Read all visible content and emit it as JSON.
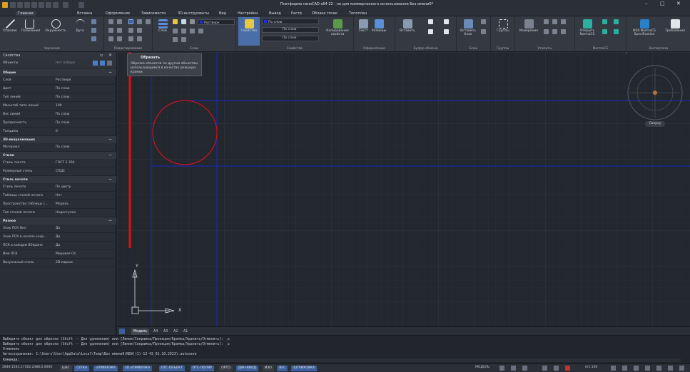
{
  "app": {
    "title": "Платформа nanoCAD x64 22 - не для коммерческого использования Без имени0*"
  },
  "menu": [
    "Главная",
    "Вставка",
    "Оформление",
    "Зависимости",
    "3D-инструменты",
    "Вид",
    "Настройки",
    "Вывод",
    "Растр",
    "Облака точек",
    "Топоплан"
  ],
  "ribbon": {
    "groups": [
      {
        "label": "Черчение",
        "buttons": [
          "Отрезок",
          "Полилиния",
          "Окружность",
          "Дуга"
        ]
      },
      {
        "label": "Редактирование"
      },
      {
        "label": "Слои",
        "buttons": [
          "Слои"
        ]
      },
      {
        "label": "Свойства",
        "buttons": [
          "Свойства",
          "Копирование свойств"
        ],
        "combos": [
          "По слою",
          "По слою",
          "По слою"
        ],
        "layer_combo": "Ростверк"
      },
      {
        "label": "Оформление",
        "buttons": [
          "Текст",
          "Размеры"
        ]
      },
      {
        "label": "Буфер обмена",
        "buttons": [
          "Вставить"
        ]
      },
      {
        "label": "Блок",
        "buttons": [
          "Вставить блок"
        ]
      },
      {
        "label": "Группы",
        "buttons": [
          "Группы"
        ]
      },
      {
        "label": "Утилиты",
        "buttons": [
          "Измерение"
        ]
      },
      {
        "label": "NormaCS",
        "buttons": [
          "Открыть NormaCS"
        ]
      },
      {
        "label": "Экспертиза",
        "buttons": [
          "NSR NormaCS Specification",
          "Требования"
        ]
      }
    ]
  },
  "tooltip": {
    "title": "Обрезать",
    "text": "Обрезка объектов по другим объектам, использующимся в качестве режущих кромок"
  },
  "properties": {
    "title": "Свойства",
    "selection_label": "Объекты",
    "selection_value": "Нет набора",
    "sections": [
      {
        "name": "Общие",
        "rows": [
          {
            "k": "Слой",
            "v": "Ростверк"
          },
          {
            "k": "Цвет",
            "v": "По слою"
          },
          {
            "k": "Тип линий",
            "v": "По слою"
          },
          {
            "k": "Масштаб типа линий",
            "v": "100"
          },
          {
            "k": "Вес линий",
            "v": "По слою"
          },
          {
            "k": "Прозрачность",
            "v": "По слою"
          },
          {
            "k": "Толщина",
            "v": "0"
          }
        ]
      },
      {
        "name": "3D-визуализация",
        "rows": [
          {
            "k": "Материал",
            "v": "По слою"
          }
        ]
      },
      {
        "name": "Стили",
        "rows": [
          {
            "k": "Стиль текста",
            "v": "ГОСТ 2.304"
          },
          {
            "k": "Размерный стиль",
            "v": "СПДС"
          }
        ]
      },
      {
        "name": "Стиль печати",
        "rows": [
          {
            "k": "Стиль печати",
            "v": "По цвету"
          },
          {
            "k": "Таблица стилей печати",
            "v": "Нет"
          },
          {
            "k": "Пространство таблицы с...",
            "v": "Модель"
          },
          {
            "k": "Тип стилей печати",
            "v": "Недоступен"
          }
        ]
      },
      {
        "name": "Разное",
        "rows": [
          {
            "k": "Знак ПСК Вкл",
            "v": "Да"
          },
          {
            "k": "Знак ПСК в начале коор...",
            "v": "Да"
          },
          {
            "k": "ПСК в каждом ВЭкране",
            "v": "Да"
          },
          {
            "k": "Имя ПСК",
            "v": "Мировая СК"
          },
          {
            "k": "Визуальный стиль",
            "v": "2D-каркас"
          }
        ]
      }
    ]
  },
  "viewcube": {
    "label": "Сверху"
  },
  "ucs": {
    "x": "X",
    "y": "Y"
  },
  "layout_tabs": [
    "Модель",
    "A4",
    "A3",
    "A2",
    "A1"
  ],
  "command_lines": [
    "Выберите объект для обрезки (Shift -- Для удлинения) или [Линия/Секрамка/Проекция/Кромка/Удалить/Отменить]: _u",
    "Выберите объект для обрезки (Shift -- Для удлинения) или [Линия/Секрамка/Проекция/Кромка/Удалить/Отменить]: _u",
    "Отменено",
    "Автосохранение: C:\\Users\\User\\AppData\\Local\\Temp\\Без имени0(NEW)(1)-13-43_01.10.2023).autosave",
    "Команда:"
  ],
  "status": {
    "coords": "2849.1544,17162.2488,0.0000",
    "buttons": [
      {
        "label": "ШАГ",
        "on": false
      },
      {
        "label": "СЕТКА",
        "on": true
      },
      {
        "label": "оПРИВЯЗКА",
        "on": true
      },
      {
        "label": "3D оПРИВЯЗКА",
        "on": true
      },
      {
        "label": "ОТС-ОБЪЕКТ",
        "on": true
      },
      {
        "label": "ОТС-ПОЛЯР",
        "on": true
      },
      {
        "label": "ОРТО",
        "on": false
      },
      {
        "label": "ДИН-ВВОД",
        "on": true
      },
      {
        "label": "ИЗО",
        "on": false
      },
      {
        "label": "ВЕС",
        "on": true
      },
      {
        "label": "ШТРИХОВКА",
        "on": true
      }
    ],
    "model": "МОДЕЛЬ",
    "scale": "m1:100"
  },
  "colors": {
    "accent": "#3b5f9a",
    "circle": "#d01020",
    "lines": "#1428c8",
    "arrow": "#e01010"
  }
}
